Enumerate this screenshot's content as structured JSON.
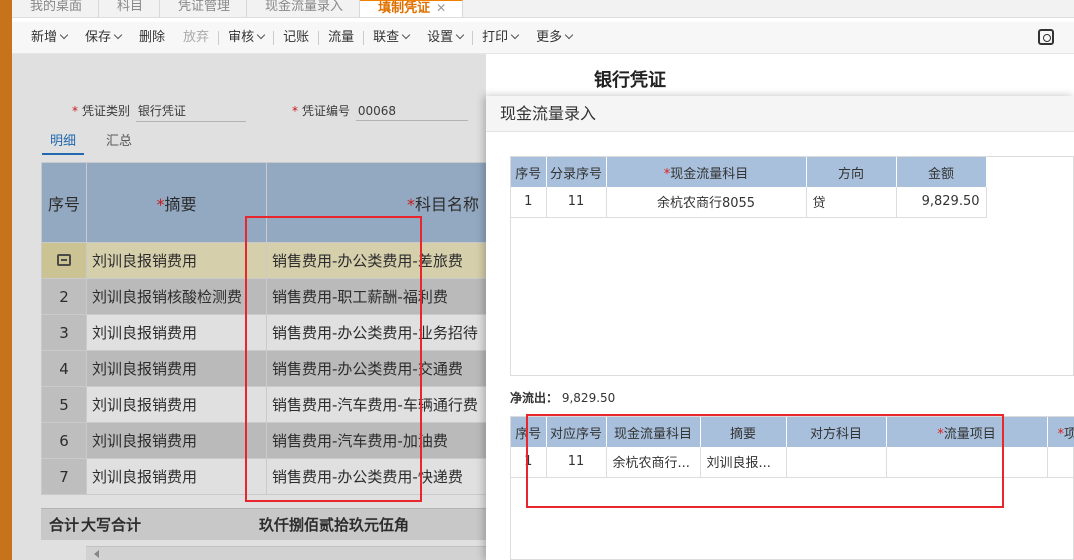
{
  "tabs": [
    {
      "label": "我的桌面",
      "active": false
    },
    {
      "label": "科目",
      "active": false
    },
    {
      "label": "凭证管理",
      "active": false
    },
    {
      "label": "现金流量录入",
      "active": false
    },
    {
      "label": "填制凭证",
      "active": true
    }
  ],
  "tab_close": "✕",
  "toolbar": {
    "new": "新增",
    "save": "保存",
    "delete": "删除",
    "discard": "放弃",
    "audit": "审核",
    "post": "记账",
    "cashflow": "流量",
    "query": "联查",
    "settings": "设置",
    "print": "打印",
    "more": "更多"
  },
  "voucher": {
    "title": "银行凭证",
    "type_label": "凭证类别",
    "type_value": "银行凭证",
    "no_label": "凭证编号",
    "no_value": "00068",
    "subtab_detail": "明细",
    "subtab_summary": "汇总"
  },
  "grid": {
    "headers": {
      "seq": "序号",
      "summary": "摘要",
      "account": "科目名称"
    },
    "rows": [
      {
        "seq": "",
        "summary": "刘训良报销费用",
        "account": "销售费用-办公类费用-差旅费"
      },
      {
        "seq": "2",
        "summary": "刘训良报销核酸检测费",
        "account": "销售费用-职工薪酬-福利费"
      },
      {
        "seq": "3",
        "summary": "刘训良报销费用",
        "account": "销售费用-办公类费用-业务招待"
      },
      {
        "seq": "4",
        "summary": "刘训良报销费用",
        "account": "销售费用-办公类费用-交通费"
      },
      {
        "seq": "5",
        "summary": "刘训良报销费用",
        "account": "销售费用-汽车费用-车辆通行费"
      },
      {
        "seq": "6",
        "summary": "刘训良报销费用",
        "account": "销售费用-汽车费用-加油费"
      },
      {
        "seq": "7",
        "summary": "刘训良报销费用",
        "account": "销售费用-办公类费用-快递费"
      }
    ],
    "total_label": "合计",
    "total_caps_label": "大写合计",
    "total_caps_value": "玖仟捌佰贰拾玖元伍角"
  },
  "modal": {
    "title": "现金流量录入",
    "top_headers": {
      "seq": "序号",
      "entry_seq": "分录序号",
      "account": "现金流量科目",
      "direction": "方向",
      "amount": "金额"
    },
    "top_rows": [
      {
        "seq": "1",
        "entry_seq": "11",
        "account": "余杭农商行8055",
        "direction": "贷",
        "amount": "9,829.50"
      }
    ],
    "net_out_label": "净流出：",
    "net_out_value": "9,829.50",
    "bottom_headers": {
      "seq": "序号",
      "entry_seq": "对应序号",
      "account": "现金流量科目",
      "summary": "摘要",
      "counter_account": "对方科目",
      "item": "流量项目",
      "extra": "项"
    },
    "bottom_rows": [
      {
        "seq": "1",
        "entry_seq": "11",
        "account": "余杭农商行...",
        "summary": "刘训良报...",
        "counter_account": "",
        "item": ""
      }
    ]
  }
}
